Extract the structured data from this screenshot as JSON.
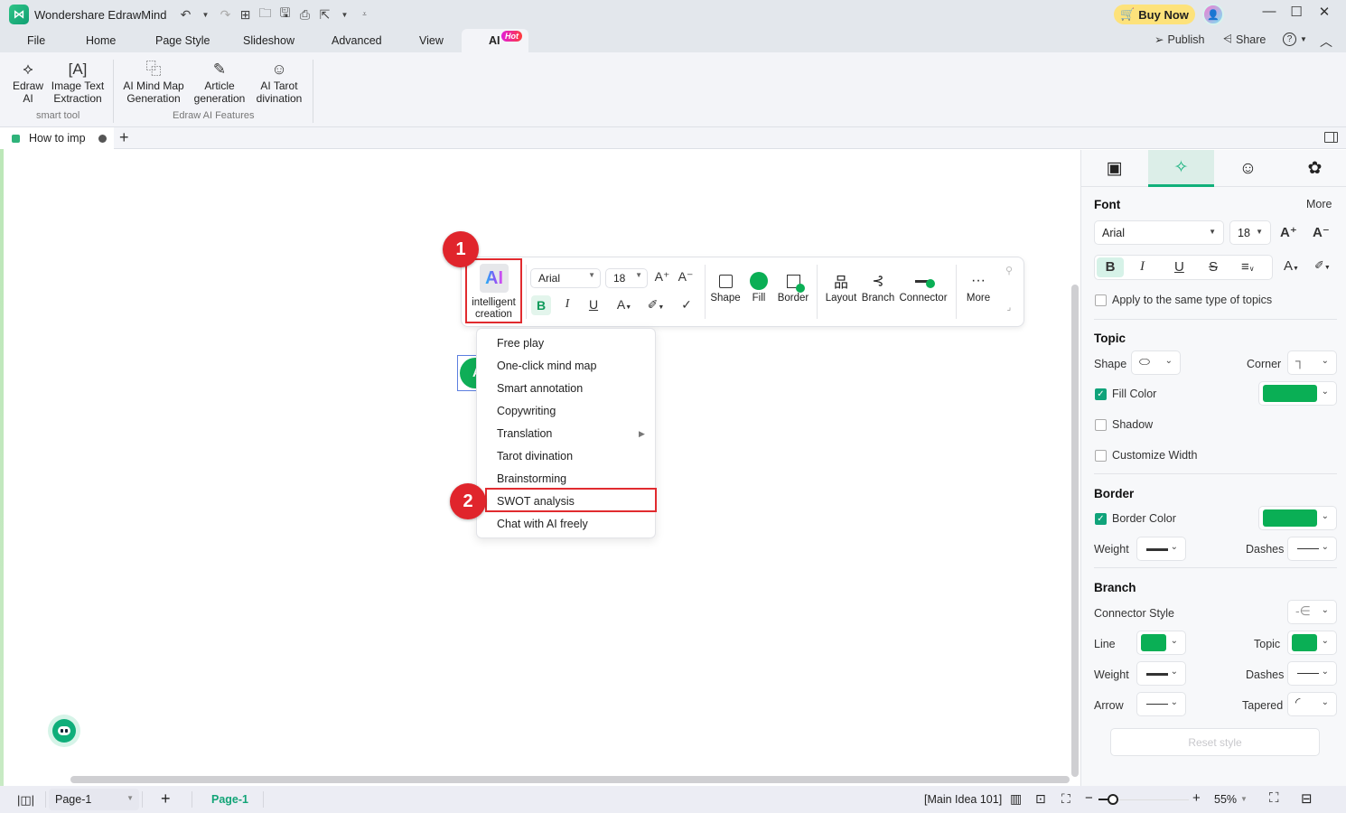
{
  "app": {
    "title": "Wondershare EdrawMind",
    "logo_glyph": "⋈",
    "quick_access_icons": [
      "undo-icon",
      "redo-icon",
      "new-icon",
      "open-folder-icon",
      "save-icon",
      "print-icon",
      "export-icon",
      "customize-icon"
    ],
    "buy_now": "Buy Now",
    "window_controls": [
      "—",
      "☐",
      "✕"
    ]
  },
  "menu": {
    "items": [
      "File",
      "Home",
      "Page Style",
      "Slideshow",
      "Advanced",
      "View"
    ],
    "active": "AI",
    "hot_badge": "Hot",
    "right": {
      "publish": "Publish",
      "share": "Share",
      "help": "?"
    }
  },
  "ribbon": {
    "groups": [
      {
        "label": "smart tool",
        "buttons": [
          {
            "label1": "Edraw",
            "label2": "AI",
            "icon": "edraw-ai-icon"
          },
          {
            "label1": "Image Text",
            "label2": "Extraction",
            "icon": "image-text-icon"
          }
        ]
      },
      {
        "label": "Edraw AI Features",
        "buttons": [
          {
            "label1": "AI Mind Map",
            "label2": "Generation",
            "icon": "ai-mindmap-icon"
          },
          {
            "label1": "Article",
            "label2": "generation",
            "icon": "article-icon"
          },
          {
            "label1": "AI Tarot",
            "label2": "divination",
            "icon": "tarot-icon"
          }
        ]
      }
    ]
  },
  "document_tab": {
    "name": "How to imp",
    "add": "+"
  },
  "canvas": {
    "node_initial": "A",
    "floating_toolbar": {
      "ai_label": "AI",
      "ai_caption1": "intelligent",
      "ai_caption2": "creation",
      "font": "Arial",
      "size": "18",
      "tools": [
        "Shape",
        "Fill",
        "Border",
        "Layout",
        "Branch",
        "Connector",
        "More"
      ]
    },
    "annotations": {
      "step1": "1",
      "step2": "2"
    },
    "ai_menu": {
      "items": [
        "Free play",
        "One-click mind map",
        "Smart annotation",
        "Copywriting",
        "Translation",
        "Tarot divination",
        "Brainstorming",
        "SWOT analysis",
        "Chat with AI freely"
      ],
      "highlighted": "SWOT analysis",
      "submenu_item": "Translation"
    }
  },
  "side_panel": {
    "tabs": [
      "page-format-icon",
      "style-sparkle-icon",
      "emoji-icon",
      "theme-icon"
    ],
    "active_tab": 1,
    "font": {
      "heading": "Font",
      "more": "More",
      "family": "Arial",
      "size": "18",
      "apply_same": "Apply to the same type of topics"
    },
    "topic": {
      "heading": "Topic",
      "shape": "Shape",
      "corner": "Corner",
      "fill_color": "Fill Color",
      "shadow": "Shadow",
      "customize_width": "Customize Width",
      "fill_checked": true,
      "shadow_checked": false,
      "width_checked": false
    },
    "border": {
      "heading": "Border",
      "border_color": "Border Color",
      "weight": "Weight",
      "dashes": "Dashes",
      "checked": true
    },
    "branch": {
      "heading": "Branch",
      "connector_style": "Connector Style",
      "line": "Line",
      "topic": "Topic",
      "weight": "Weight",
      "dashes": "Dashes",
      "arrow": "Arrow",
      "tapered": "Tapered"
    },
    "reset": "Reset style",
    "colors": {
      "green": "#0aaf55",
      "accent": "#10b07a"
    }
  },
  "status_bar": {
    "page_select": "Page-1",
    "add_page": "+",
    "active_page": "Page-1",
    "selection": "[Main Idea 101]",
    "zoom_minus": "−",
    "zoom_plus": "+",
    "zoom": "55%",
    "zoom_level_fraction": 0.1
  }
}
